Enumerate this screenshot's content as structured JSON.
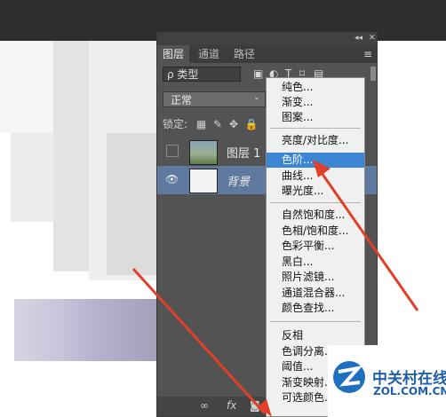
{
  "panel": {
    "tabs": [
      "图层",
      "通道",
      "路径"
    ],
    "filter_label": "ρ 类型",
    "blend_mode": "正常",
    "lock_label": "锁定:",
    "layers": [
      {
        "name": "图层 1",
        "selected": false
      },
      {
        "name": "背景",
        "selected": true
      }
    ],
    "bottom_icons": [
      "link-icon",
      "fx-icon",
      "mask-icon",
      "adjustment-icon"
    ]
  },
  "menu": {
    "items": [
      {
        "label": "纯色...",
        "highlighted": false
      },
      {
        "label": "渐变...",
        "highlighted": false
      },
      {
        "label": "图案...",
        "highlighted": false
      },
      {
        "label": "亮度/对比度...",
        "highlighted": false
      },
      {
        "label": "色阶...",
        "highlighted": true
      },
      {
        "label": "曲线...",
        "highlighted": false
      },
      {
        "label": "曝光度...",
        "highlighted": false
      },
      {
        "label": "自然饱和度...",
        "highlighted": false
      },
      {
        "label": "色相/饱和度...",
        "highlighted": false
      },
      {
        "label": "色彩平衡...",
        "highlighted": false
      },
      {
        "label": "黑白...",
        "highlighted": false
      },
      {
        "label": "照片滤镜...",
        "highlighted": false
      },
      {
        "label": "通道混合器...",
        "highlighted": false
      },
      {
        "label": "颜色查找...",
        "highlighted": false
      },
      {
        "label": "反相",
        "highlighted": false
      },
      {
        "label": "色调分离...",
        "highlighted": false
      },
      {
        "label": "阈值...",
        "highlighted": false
      },
      {
        "label": "渐变映射...",
        "highlighted": false
      },
      {
        "label": "可选颜色...",
        "highlighted": false
      }
    ]
  },
  "watermark": {
    "cn": "中关村在线",
    "en": "ZOL.COM.CN"
  },
  "colors": {
    "highlight": "#3c86d4",
    "arrow": "#e0402a",
    "panel_bg": "#535353"
  }
}
